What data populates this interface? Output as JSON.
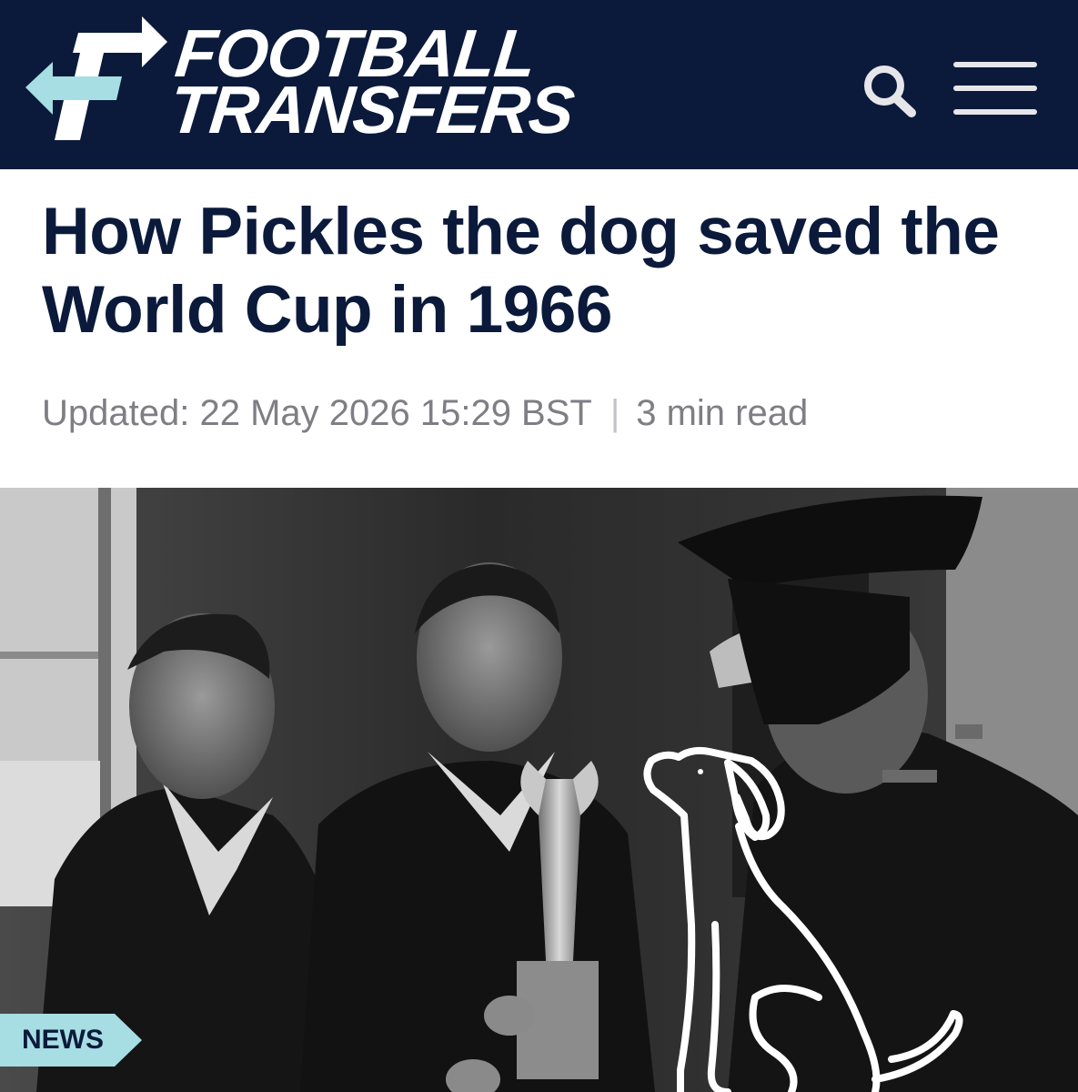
{
  "header": {
    "logo_line1": "FOOTBALL",
    "logo_line2": "TRANSFERS",
    "background_color": "#0b1a3b",
    "accent_color": "#a6dee4",
    "icons": [
      "logo-arrows-icon",
      "search-icon",
      "hamburger-menu-icon"
    ]
  },
  "article": {
    "title": "How Pickles the dog saved the World Cup in 1966",
    "updated": "Updated: 22 May 2026 15:29 BST",
    "separator": "|",
    "read_time": "3 min read",
    "category_badge": "NEWS",
    "image_icon": "dog-outline-icon"
  }
}
